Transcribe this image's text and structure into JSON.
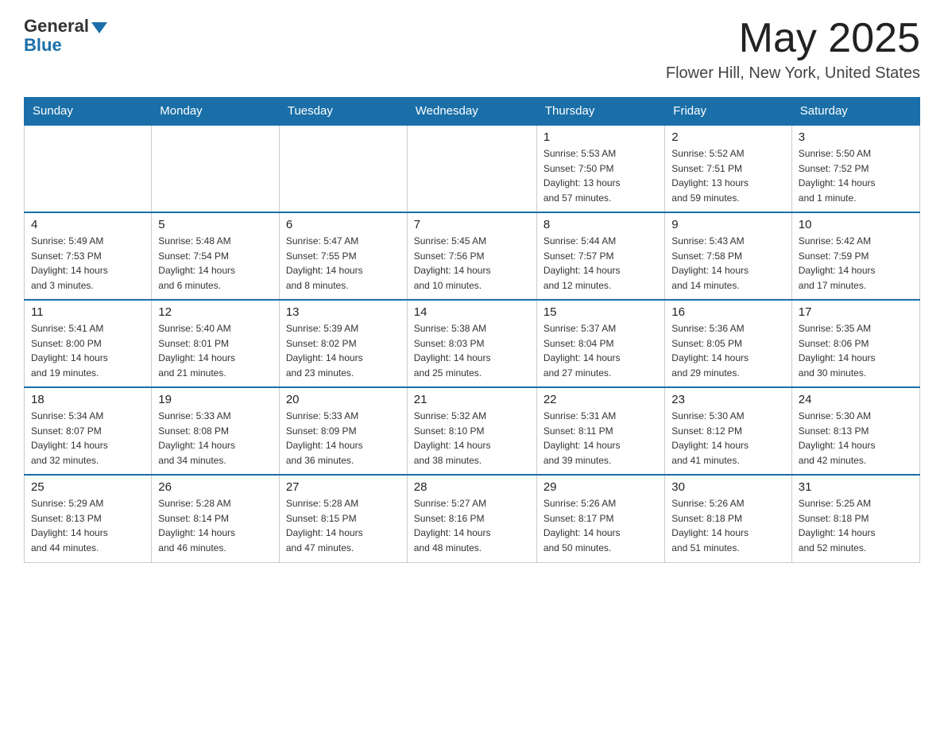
{
  "header": {
    "logo_general": "General",
    "logo_blue": "Blue",
    "month_title": "May 2025",
    "location": "Flower Hill, New York, United States"
  },
  "days_of_week": [
    "Sunday",
    "Monday",
    "Tuesday",
    "Wednesday",
    "Thursday",
    "Friday",
    "Saturday"
  ],
  "weeks": [
    [
      {
        "day": "",
        "info": ""
      },
      {
        "day": "",
        "info": ""
      },
      {
        "day": "",
        "info": ""
      },
      {
        "day": "",
        "info": ""
      },
      {
        "day": "1",
        "info": "Sunrise: 5:53 AM\nSunset: 7:50 PM\nDaylight: 13 hours\nand 57 minutes."
      },
      {
        "day": "2",
        "info": "Sunrise: 5:52 AM\nSunset: 7:51 PM\nDaylight: 13 hours\nand 59 minutes."
      },
      {
        "day": "3",
        "info": "Sunrise: 5:50 AM\nSunset: 7:52 PM\nDaylight: 14 hours\nand 1 minute."
      }
    ],
    [
      {
        "day": "4",
        "info": "Sunrise: 5:49 AM\nSunset: 7:53 PM\nDaylight: 14 hours\nand 3 minutes."
      },
      {
        "day": "5",
        "info": "Sunrise: 5:48 AM\nSunset: 7:54 PM\nDaylight: 14 hours\nand 6 minutes."
      },
      {
        "day": "6",
        "info": "Sunrise: 5:47 AM\nSunset: 7:55 PM\nDaylight: 14 hours\nand 8 minutes."
      },
      {
        "day": "7",
        "info": "Sunrise: 5:45 AM\nSunset: 7:56 PM\nDaylight: 14 hours\nand 10 minutes."
      },
      {
        "day": "8",
        "info": "Sunrise: 5:44 AM\nSunset: 7:57 PM\nDaylight: 14 hours\nand 12 minutes."
      },
      {
        "day": "9",
        "info": "Sunrise: 5:43 AM\nSunset: 7:58 PM\nDaylight: 14 hours\nand 14 minutes."
      },
      {
        "day": "10",
        "info": "Sunrise: 5:42 AM\nSunset: 7:59 PM\nDaylight: 14 hours\nand 17 minutes."
      }
    ],
    [
      {
        "day": "11",
        "info": "Sunrise: 5:41 AM\nSunset: 8:00 PM\nDaylight: 14 hours\nand 19 minutes."
      },
      {
        "day": "12",
        "info": "Sunrise: 5:40 AM\nSunset: 8:01 PM\nDaylight: 14 hours\nand 21 minutes."
      },
      {
        "day": "13",
        "info": "Sunrise: 5:39 AM\nSunset: 8:02 PM\nDaylight: 14 hours\nand 23 minutes."
      },
      {
        "day": "14",
        "info": "Sunrise: 5:38 AM\nSunset: 8:03 PM\nDaylight: 14 hours\nand 25 minutes."
      },
      {
        "day": "15",
        "info": "Sunrise: 5:37 AM\nSunset: 8:04 PM\nDaylight: 14 hours\nand 27 minutes."
      },
      {
        "day": "16",
        "info": "Sunrise: 5:36 AM\nSunset: 8:05 PM\nDaylight: 14 hours\nand 29 minutes."
      },
      {
        "day": "17",
        "info": "Sunrise: 5:35 AM\nSunset: 8:06 PM\nDaylight: 14 hours\nand 30 minutes."
      }
    ],
    [
      {
        "day": "18",
        "info": "Sunrise: 5:34 AM\nSunset: 8:07 PM\nDaylight: 14 hours\nand 32 minutes."
      },
      {
        "day": "19",
        "info": "Sunrise: 5:33 AM\nSunset: 8:08 PM\nDaylight: 14 hours\nand 34 minutes."
      },
      {
        "day": "20",
        "info": "Sunrise: 5:33 AM\nSunset: 8:09 PM\nDaylight: 14 hours\nand 36 minutes."
      },
      {
        "day": "21",
        "info": "Sunrise: 5:32 AM\nSunset: 8:10 PM\nDaylight: 14 hours\nand 38 minutes."
      },
      {
        "day": "22",
        "info": "Sunrise: 5:31 AM\nSunset: 8:11 PM\nDaylight: 14 hours\nand 39 minutes."
      },
      {
        "day": "23",
        "info": "Sunrise: 5:30 AM\nSunset: 8:12 PM\nDaylight: 14 hours\nand 41 minutes."
      },
      {
        "day": "24",
        "info": "Sunrise: 5:30 AM\nSunset: 8:13 PM\nDaylight: 14 hours\nand 42 minutes."
      }
    ],
    [
      {
        "day": "25",
        "info": "Sunrise: 5:29 AM\nSunset: 8:13 PM\nDaylight: 14 hours\nand 44 minutes."
      },
      {
        "day": "26",
        "info": "Sunrise: 5:28 AM\nSunset: 8:14 PM\nDaylight: 14 hours\nand 46 minutes."
      },
      {
        "day": "27",
        "info": "Sunrise: 5:28 AM\nSunset: 8:15 PM\nDaylight: 14 hours\nand 47 minutes."
      },
      {
        "day": "28",
        "info": "Sunrise: 5:27 AM\nSunset: 8:16 PM\nDaylight: 14 hours\nand 48 minutes."
      },
      {
        "day": "29",
        "info": "Sunrise: 5:26 AM\nSunset: 8:17 PM\nDaylight: 14 hours\nand 50 minutes."
      },
      {
        "day": "30",
        "info": "Sunrise: 5:26 AM\nSunset: 8:18 PM\nDaylight: 14 hours\nand 51 minutes."
      },
      {
        "day": "31",
        "info": "Sunrise: 5:25 AM\nSunset: 8:18 PM\nDaylight: 14 hours\nand 52 minutes."
      }
    ]
  ]
}
